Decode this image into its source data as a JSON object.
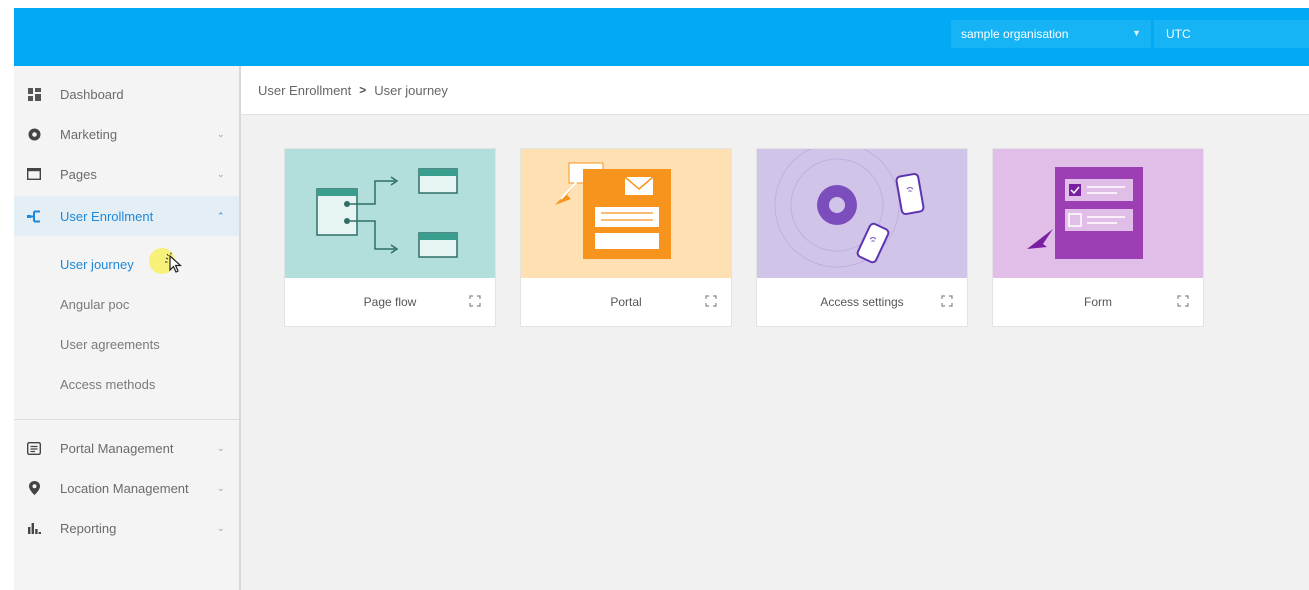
{
  "topbar": {
    "organisation": "sample organisation",
    "timezone": "UTC"
  },
  "sidebar": {
    "items": [
      {
        "label": "Dashboard",
        "icon": "dashboard-icon"
      },
      {
        "label": "Marketing",
        "icon": "marketing-icon"
      },
      {
        "label": "Pages",
        "icon": "pages-icon"
      },
      {
        "label": "User Enrollment",
        "icon": "user-enrollment-icon"
      },
      {
        "label": "Portal Management",
        "icon": "portal-management-icon"
      },
      {
        "label": "Location Management",
        "icon": "location-pin-icon"
      },
      {
        "label": "Reporting",
        "icon": "reporting-icon"
      }
    ],
    "sub_items": [
      {
        "label": "User journey"
      },
      {
        "label": "Angular poc"
      },
      {
        "label": "User agreements"
      },
      {
        "label": "Access methods"
      }
    ]
  },
  "breadcrumb": {
    "parent": "User Enrollment",
    "current": "User journey"
  },
  "cards": [
    {
      "label": "Page flow",
      "color": "#b2dfdb"
    },
    {
      "label": "Portal",
      "color": "#ffe0b2"
    },
    {
      "label": "Access settings",
      "color": "#d1c4e9"
    },
    {
      "label": "Form",
      "color": "#e1bee7"
    }
  ],
  "colors": {
    "topbar": "#02a9f4",
    "active": "#1e88d8"
  }
}
